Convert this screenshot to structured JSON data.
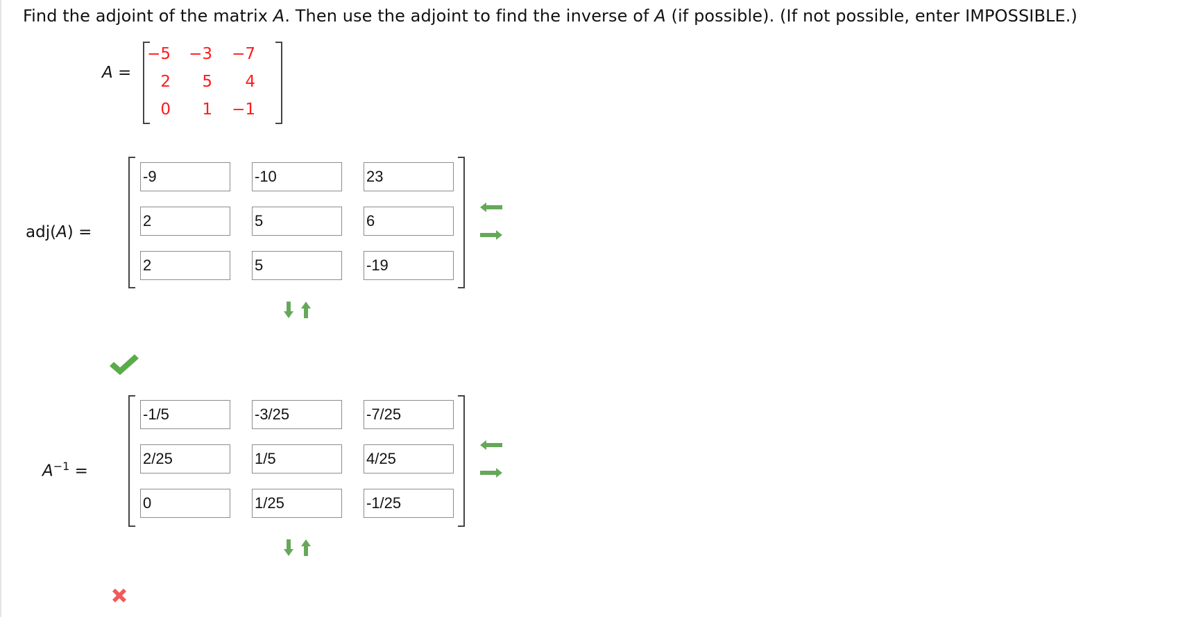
{
  "question": {
    "p1": "Find the adjoint of the matrix ",
    "var1": "A",
    "p2": ". Then use the adjoint to find the inverse of ",
    "var2": "A",
    "p3": " (if possible). (If not possible, enter IMPOSSIBLE.)"
  },
  "given": {
    "label_var": "A",
    "label_eq": " =",
    "rows": [
      [
        "−5",
        "−3",
        "−7"
      ],
      [
        "2",
        "5",
        "4"
      ],
      [
        "0",
        "1",
        "−1"
      ]
    ],
    "value_color": "#ff1a1a"
  },
  "adjoint": {
    "label_pre": "adj(",
    "label_var": "A",
    "label_post": ")  =",
    "rows": [
      [
        "-9",
        "-10",
        "23"
      ],
      [
        "2",
        "5",
        "6"
      ],
      [
        "2",
        "5",
        "-19"
      ]
    ],
    "status": "correct-check-icon"
  },
  "inverse": {
    "label_var": "A",
    "label_sup": "−1",
    "label_eq": " =",
    "rows": [
      [
        "-1/5",
        "-3/25",
        "-7/25"
      ],
      [
        "2/25",
        "1/5",
        "4/25"
      ],
      [
        "0",
        "1/25",
        "-1/25"
      ]
    ],
    "status": "incorrect-x-icon"
  },
  "colors": {
    "arrow_green": "#66a85a",
    "check_green": "#5aac4a",
    "x_red": "#f05a5a"
  }
}
